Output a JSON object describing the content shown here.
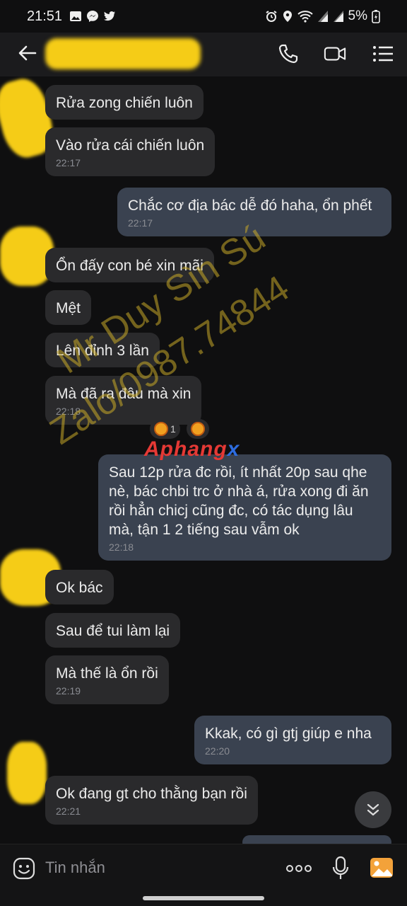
{
  "status_bar": {
    "time": "21:51",
    "battery": "5%",
    "left_icons": [
      "gallery-icon",
      "messenger-icon",
      "twitter-icon"
    ],
    "right_icons": [
      "alarm-icon",
      "location-icon",
      "wifi-icon",
      "signal-icon",
      "signal-icon",
      "battery-icon"
    ]
  },
  "header": {
    "icons": [
      "back-arrow-icon",
      "phone-icon",
      "video-call-icon",
      "menu-list-icon"
    ]
  },
  "messages": [
    {
      "dir": "in",
      "text": "Rửa zong chiến luôn",
      "time": ""
    },
    {
      "dir": "in",
      "text": "Vào rửa cái chiến luôn",
      "time": "22:17"
    },
    {
      "dir": "out",
      "text": "Chắc cơ địa bác dễ đó haha, ổn phết",
      "time": "22:17"
    },
    {
      "dir": "in",
      "text": "Ổn đấy con bé xin mãi",
      "time": ""
    },
    {
      "dir": "in",
      "text": "Mệt",
      "time": ""
    },
    {
      "dir": "in",
      "text": "Lên đỉnh 3 lần",
      "time": ""
    },
    {
      "dir": "in",
      "text": "Mà đã ra đâu mà xin",
      "time": "22:18"
    },
    {
      "dir": "out",
      "text": "Sau 12p rửa đc rồi, ít nhất 20p sau qhe nè, bác chbi trc ở nhà á, rửa xong đi ăn rồi hẳn chicj cũng đc, có tác dụng lâu mà, tận 1 2 tiếng sau vẫm ok",
      "time": "22:18"
    },
    {
      "dir": "in",
      "text": "Ok bác",
      "time": ""
    },
    {
      "dir": "in",
      "text": "Sau để tui làm lại",
      "time": ""
    },
    {
      "dir": "in",
      "text": "Mà thế là ổn rồi",
      "time": "22:19"
    },
    {
      "dir": "out",
      "text": "Kkak, có gì gtj giúp e nha",
      "time": "22:20"
    },
    {
      "dir": "in",
      "text": "Ok đang gt cho thằng bạn rồi",
      "time": "22:21"
    }
  ],
  "reaction": {
    "count": "1"
  },
  "watermark": {
    "line1": "Mr Duy Sìn Sú",
    "line2": "Zalo/0987.74844",
    "brand_a": "Aphang",
    "brand_b": "x"
  },
  "input": {
    "placeholder": "Tin nhắn",
    "icons": [
      "emoji-icon",
      "more-icon",
      "microphone-icon",
      "image-icon"
    ]
  },
  "colors": {
    "background": "#0f0f10",
    "incoming_bubble": "#2a2a2c",
    "outgoing_bubble": "#3a4250",
    "censor_yellow": "#f5cc17"
  }
}
